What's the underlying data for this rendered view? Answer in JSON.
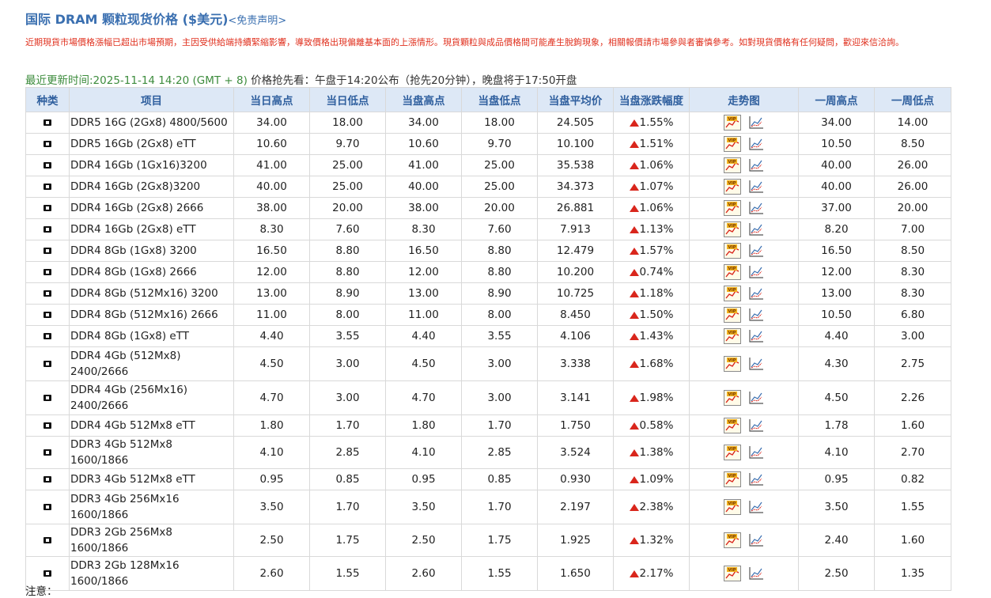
{
  "header": {
    "title": "国际 DRAM 颗粒现货价格 ($美元)",
    "disclaimer_link": "<免责声明>",
    "notice": "近期現貨市場價格漲幅已超出市場預期，主因受供給端持續緊縮影響，導致價格出現偏離基本面的上漲情形。現貨顆粒與成品價格間可能產生脫鉤現象，相關報價請市場參與者審慎參考。如對現貨價格有任何疑問，歡迎來信洽詢。",
    "update_label": "最近更新时间:2025-11-14 14:20 (GMT + 8)",
    "update_info": "价格抢先看：午盘于14:20公布（抢先20分钟），晚盘将于17:50开盘"
  },
  "table": {
    "columns": [
      "种类",
      "项目",
      "当日高点",
      "当日低点",
      "当盘高点",
      "当盘低点",
      "当盘平均价",
      "当盘涨跌幅度",
      "走势图",
      "一周高点",
      "一周低点"
    ],
    "rows": [
      {
        "name": "DDR5 16G (2Gx8) 4800/5600",
        "day_high": "34.00",
        "day_low": "18.00",
        "sess_high": "34.00",
        "sess_low": "18.00",
        "avg": "24.505",
        "change": "1.55%",
        "week_high": "34.00",
        "week_low": "14.00"
      },
      {
        "name": "DDR5 16Gb (2Gx8) eTT",
        "day_high": "10.60",
        "day_low": "9.70",
        "sess_high": "10.60",
        "sess_low": "9.70",
        "avg": "10.100",
        "change": "1.51%",
        "week_high": "10.50",
        "week_low": "8.50"
      },
      {
        "name": "DDR4 16Gb (1Gx16)3200",
        "day_high": "41.00",
        "day_low": "25.00",
        "sess_high": "41.00",
        "sess_low": "25.00",
        "avg": "35.538",
        "change": "1.06%",
        "week_high": "40.00",
        "week_low": "26.00"
      },
      {
        "name": "DDR4 16Gb (2Gx8)3200",
        "day_high": "40.00",
        "day_low": "25.00",
        "sess_high": "40.00",
        "sess_low": "25.00",
        "avg": "34.373",
        "change": "1.07%",
        "week_high": "40.00",
        "week_low": "26.00"
      },
      {
        "name": "DDR4 16Gb (2Gx8) 2666",
        "day_high": "38.00",
        "day_low": "20.00",
        "sess_high": "38.00",
        "sess_low": "20.00",
        "avg": "26.881",
        "change": "1.06%",
        "week_high": "37.00",
        "week_low": "20.00"
      },
      {
        "name": "DDR4 16Gb (2Gx8) eTT",
        "day_high": "8.30",
        "day_low": "7.60",
        "sess_high": "8.30",
        "sess_low": "7.60",
        "avg": "7.913",
        "change": "1.13%",
        "week_high": "8.20",
        "week_low": "7.00"
      },
      {
        "name": "DDR4 8Gb (1Gx8) 3200",
        "day_high": "16.50",
        "day_low": "8.80",
        "sess_high": "16.50",
        "sess_low": "8.80",
        "avg": "12.479",
        "change": "1.57%",
        "week_high": "16.50",
        "week_low": "8.50"
      },
      {
        "name": "DDR4 8Gb (1Gx8) 2666",
        "day_high": "12.00",
        "day_low": "8.80",
        "sess_high": "12.00",
        "sess_low": "8.80",
        "avg": "10.200",
        "change": "0.74%",
        "week_high": "12.00",
        "week_low": "8.30"
      },
      {
        "name": "DDR4 8Gb (512Mx16) 3200",
        "day_high": "13.00",
        "day_low": "8.90",
        "sess_high": "13.00",
        "sess_low": "8.90",
        "avg": "10.725",
        "change": "1.18%",
        "week_high": "13.00",
        "week_low": "8.30"
      },
      {
        "name": "DDR4 8Gb (512Mx16) 2666",
        "day_high": "11.00",
        "day_low": "8.00",
        "sess_high": "11.00",
        "sess_low": "8.00",
        "avg": "8.450",
        "change": "1.50%",
        "week_high": "10.50",
        "week_low": "6.80"
      },
      {
        "name": "DDR4 8Gb (1Gx8) eTT",
        "day_high": "4.40",
        "day_low": "3.55",
        "sess_high": "4.40",
        "sess_low": "3.55",
        "avg": "4.106",
        "change": "1.43%",
        "week_high": "4.40",
        "week_low": "3.00"
      },
      {
        "name": "DDR4 4Gb (512Mx8) 2400/2666",
        "day_high": "4.50",
        "day_low": "3.00",
        "sess_high": "4.50",
        "sess_low": "3.00",
        "avg": "3.338",
        "change": "1.68%",
        "week_high": "4.30",
        "week_low": "2.75"
      },
      {
        "name": "DDR4 4Gb (256Mx16) 2400/2666",
        "day_high": "4.70",
        "day_low": "3.00",
        "sess_high": "4.70",
        "sess_low": "3.00",
        "avg": "3.141",
        "change": "1.98%",
        "week_high": "4.50",
        "week_low": "2.26"
      },
      {
        "name": "DDR4 4Gb 512Mx8 eTT",
        "day_high": "1.80",
        "day_low": "1.70",
        "sess_high": "1.80",
        "sess_low": "1.70",
        "avg": "1.750",
        "change": "0.58%",
        "week_high": "1.78",
        "week_low": "1.60"
      },
      {
        "name": "DDR3 4Gb 512Mx8 1600/1866",
        "day_high": "4.10",
        "day_low": "2.85",
        "sess_high": "4.10",
        "sess_low": "2.85",
        "avg": "3.524",
        "change": "1.38%",
        "week_high": "4.10",
        "week_low": "2.70"
      },
      {
        "name": "DDR3 4Gb 512Mx8 eTT",
        "day_high": "0.95",
        "day_low": "0.85",
        "sess_high": "0.95",
        "sess_low": "0.85",
        "avg": "0.930",
        "change": "1.09%",
        "week_high": "0.95",
        "week_low": "0.82"
      },
      {
        "name": "DDR3 4Gb 256Mx16 1600/1866",
        "day_high": "3.50",
        "day_low": "1.70",
        "sess_high": "3.50",
        "sess_low": "1.70",
        "avg": "2.197",
        "change": "2.38%",
        "week_high": "3.50",
        "week_low": "1.55"
      },
      {
        "name": "DDR3 2Gb 256Mx8 1600/1866",
        "day_high": "2.50",
        "day_low": "1.75",
        "sess_high": "2.50",
        "sess_low": "1.75",
        "avg": "1.925",
        "change": "1.32%",
        "week_high": "2.40",
        "week_low": "1.60"
      },
      {
        "name": "DDR3 2Gb 128Mx16 1600/1866",
        "day_high": "2.60",
        "day_low": "1.55",
        "sess_high": "2.60",
        "sess_low": "1.55",
        "avg": "1.650",
        "change": "2.17%",
        "week_high": "2.50",
        "week_low": "1.35"
      }
    ]
  },
  "footer": {
    "note_label": "注意："
  },
  "icons": {
    "type_icon": "chip-type-icon",
    "change_icon": "up-arrow-icon",
    "trend_icons": [
      "vip-chart-icon",
      "line-chart-icon"
    ]
  },
  "colors": {
    "header_bg": "#dde8f6",
    "header_text": "#2f5f9e",
    "title": "#3a6fb0",
    "notice": "#e0301e",
    "timestamp": "#3d8c3d",
    "up_arrow": "#d9261c"
  }
}
